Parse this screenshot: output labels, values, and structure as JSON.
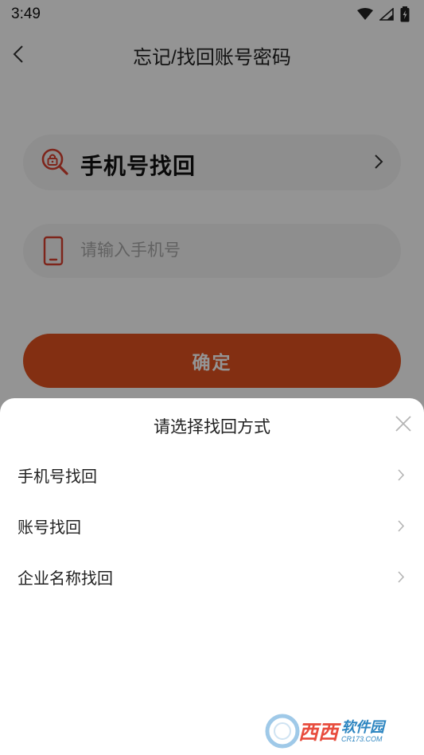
{
  "status_bar": {
    "time": "3:49"
  },
  "header": {
    "title": "忘记/找回账号密码"
  },
  "form": {
    "method_label": "手机号找回",
    "phone_placeholder": "请输入手机号",
    "confirm_label": "确定"
  },
  "sheet": {
    "title": "请选择找回方式",
    "options": [
      {
        "label": "手机号找回"
      },
      {
        "label": "账号找回"
      },
      {
        "label": "企业名称找回"
      }
    ]
  },
  "watermark": {
    "main": "西西",
    "cn": "软件园",
    "en": "CR173.COM"
  },
  "colors": {
    "accent": "#e2521f",
    "field_bg": "#f4f4f4",
    "icon_red": "#d9402f"
  },
  "icons": [
    "wifi-icon",
    "signal-icon",
    "battery-icon",
    "back-icon",
    "lock-search-icon",
    "chevron-right-icon",
    "phone-icon",
    "close-icon"
  ]
}
